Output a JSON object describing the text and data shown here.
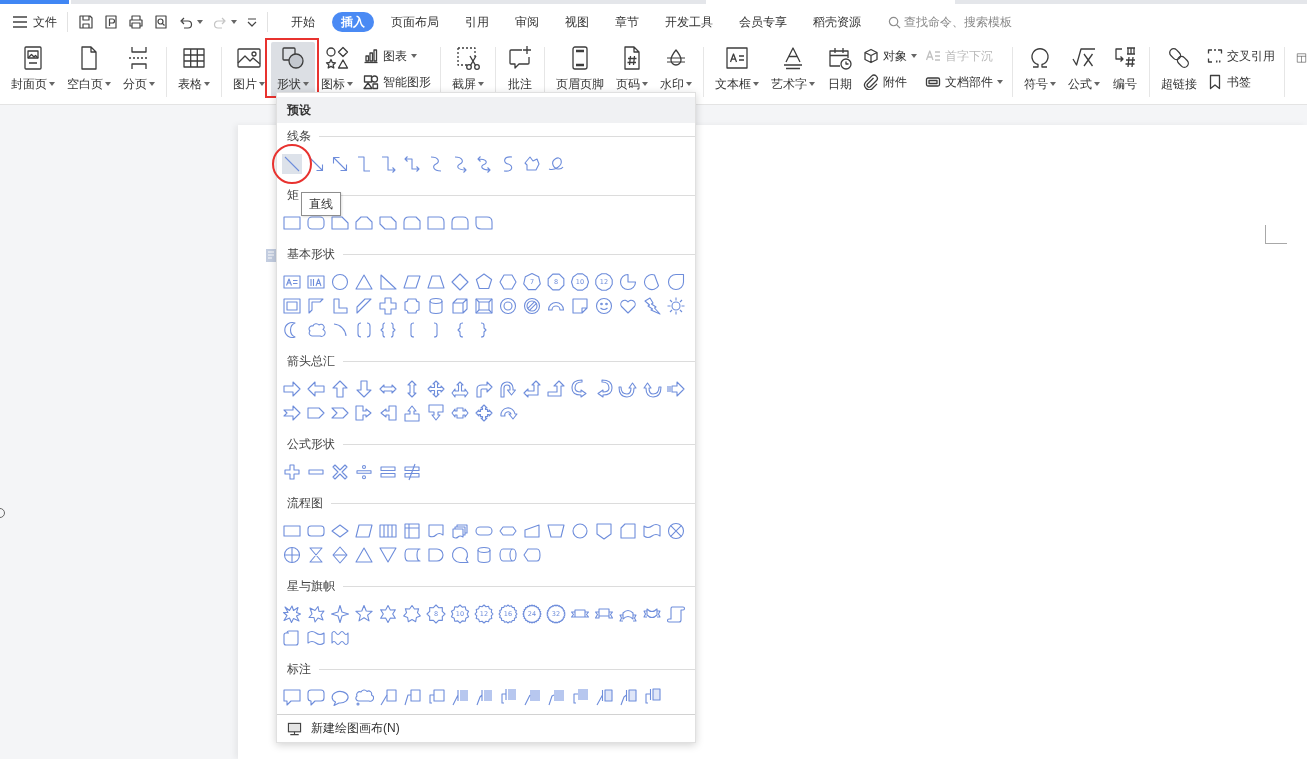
{
  "menu": {
    "label": "文件"
  },
  "quick_tools": [
    {
      "dropdown": false,
      "disabled": false
    },
    {
      "dropdown": false,
      "disabled": false
    },
    {
      "dropdown": false,
      "disabled": false
    },
    {
      "dropdown": false,
      "disabled": false
    },
    {
      "dropdown": true,
      "disabled": false
    },
    {
      "dropdown": true,
      "disabled": true
    },
    {
      "dropdown": false,
      "disabled": false
    }
  ],
  "tabs": [
    {
      "label": "开始",
      "selected": false
    },
    {
      "label": "插入",
      "selected": true
    },
    {
      "label": "页面布局",
      "selected": false
    },
    {
      "label": "引用",
      "selected": false
    },
    {
      "label": "审阅",
      "selected": false
    },
    {
      "label": "视图",
      "selected": false
    },
    {
      "label": "章节",
      "selected": false
    },
    {
      "label": "开发工具",
      "selected": false
    },
    {
      "label": "会员专享",
      "selected": false
    },
    {
      "label": "稻壳资源",
      "selected": false
    }
  ],
  "search": {
    "placeholder": "查找命令、搜索模板"
  },
  "ribbon": {
    "groups": [
      {
        "items": [
          {
            "kind": "large",
            "label": "封面页",
            "dropdown": true,
            "pressed": false,
            "disabled": false,
            "marked": false
          },
          {
            "kind": "large",
            "label": "空白页",
            "dropdown": true,
            "pressed": false,
            "disabled": false,
            "marked": false
          },
          {
            "kind": "large",
            "label": "分页",
            "dropdown": true,
            "pressed": false,
            "disabled": false,
            "marked": false
          }
        ]
      },
      {
        "items": [
          {
            "kind": "large",
            "label": "表格",
            "dropdown": true,
            "pressed": false,
            "disabled": false,
            "marked": false
          }
        ]
      },
      {
        "items": [
          {
            "kind": "large",
            "label": "图片",
            "dropdown": true,
            "pressed": false,
            "disabled": false,
            "marked": false
          },
          {
            "kind": "large",
            "label": "形状",
            "dropdown": true,
            "pressed": true,
            "disabled": false,
            "marked": true
          },
          {
            "kind": "large",
            "label": "图标",
            "dropdown": true,
            "pressed": false,
            "disabled": false,
            "marked": false
          },
          {
            "kind": "stack",
            "buttons": [
              {
                "label": "图表",
                "dropdown": true,
                "pressed": false,
                "disabled": false,
                "marked": false
              },
              {
                "label": "智能图形",
                "dropdown": false,
                "pressed": false,
                "disabled": false,
                "marked": false
              }
            ]
          }
        ]
      },
      {
        "items": [
          {
            "kind": "large",
            "label": "截屏",
            "dropdown": true,
            "pressed": false,
            "disabled": false,
            "marked": false
          }
        ]
      },
      {
        "items": [
          {
            "kind": "large",
            "label": "批注",
            "dropdown": false,
            "pressed": false,
            "disabled": false,
            "marked": false
          }
        ]
      },
      {
        "items": [
          {
            "kind": "large",
            "label": "页眉页脚",
            "dropdown": false,
            "pressed": false,
            "disabled": false,
            "marked": false
          },
          {
            "kind": "large",
            "label": "页码",
            "dropdown": true,
            "pressed": false,
            "disabled": false,
            "marked": false
          },
          {
            "kind": "large",
            "label": "水印",
            "dropdown": true,
            "pressed": false,
            "disabled": false,
            "marked": false
          }
        ]
      },
      {
        "items": [
          {
            "kind": "large",
            "label": "文本框",
            "dropdown": true,
            "pressed": false,
            "disabled": false,
            "marked": false
          },
          {
            "kind": "large",
            "label": "艺术字",
            "dropdown": true,
            "pressed": false,
            "disabled": false,
            "marked": false
          },
          {
            "kind": "large",
            "label": "日期",
            "dropdown": false,
            "pressed": false,
            "disabled": false,
            "marked": false
          },
          {
            "kind": "stack",
            "buttons": [
              {
                "label": "对象",
                "dropdown": true,
                "pressed": false,
                "disabled": false,
                "marked": false
              },
              {
                "label": "附件",
                "dropdown": false,
                "pressed": false,
                "disabled": false,
                "marked": false
              }
            ]
          },
          {
            "kind": "stack",
            "buttons": [
              {
                "label": "首字下沉",
                "dropdown": false,
                "pressed": false,
                "disabled": true,
                "marked": false
              },
              {
                "label": "文档部件",
                "dropdown": true,
                "pressed": false,
                "disabled": false,
                "marked": false
              }
            ]
          }
        ]
      },
      {
        "items": [
          {
            "kind": "large",
            "label": "符号",
            "dropdown": true,
            "pressed": false,
            "disabled": false,
            "marked": false
          },
          {
            "kind": "large",
            "label": "公式",
            "dropdown": true,
            "pressed": false,
            "disabled": false,
            "marked": false
          },
          {
            "kind": "large",
            "label": "编号",
            "dropdown": false,
            "pressed": false,
            "disabled": false,
            "marked": false
          }
        ]
      },
      {
        "items": [
          {
            "kind": "large",
            "label": "超链接",
            "dropdown": false,
            "pressed": false,
            "disabled": false,
            "marked": false
          },
          {
            "kind": "stack",
            "buttons": [
              {
                "label": "交叉引用",
                "dropdown": false,
                "pressed": false,
                "disabled": false,
                "marked": false
              },
              {
                "label": "书签",
                "dropdown": false,
                "pressed": false,
                "disabled": false,
                "marked": false
              }
            ]
          }
        ]
      }
    ]
  },
  "shapes_panel": {
    "header": "预设",
    "tooltip": "直线",
    "sections": [
      {
        "title": "线条",
        "shapes": [
          {
            "hovered": true,
            "marked": true
          },
          {
            "hovered": false,
            "marked": false
          },
          {
            "hovered": false,
            "marked": false
          },
          {
            "hovered": false,
            "marked": false
          },
          {
            "hovered": false,
            "marked": false
          },
          {
            "hovered": false,
            "marked": false
          },
          {
            "hovered": false,
            "marked": false
          },
          {
            "hovered": false,
            "marked": false
          },
          {
            "hovered": false,
            "marked": false
          },
          {
            "hovered": false,
            "marked": false
          },
          {
            "hovered": false,
            "marked": false
          },
          {
            "hovered": false,
            "marked": false
          }
        ]
      },
      {
        "title": "矩",
        "shapes": [
          {
            "hovered": false,
            "marked": false
          },
          {
            "hovered": false,
            "marked": false
          },
          {
            "hovered": false,
            "marked": false
          },
          {
            "hovered": false,
            "marked": false
          },
          {
            "hovered": false,
            "marked": false
          },
          {
            "hovered": false,
            "marked": false
          },
          {
            "hovered": false,
            "marked": false
          },
          {
            "hovered": false,
            "marked": false
          },
          {
            "hovered": false,
            "marked": false
          }
        ]
      },
      {
        "title": "基本形状",
        "shapes": [
          {
            "hovered": false,
            "marked": false
          },
          {
            "hovered": false,
            "marked": false
          },
          {
            "hovered": false,
            "marked": false
          },
          {
            "hovered": false,
            "marked": false
          },
          {
            "hovered": false,
            "marked": false
          },
          {
            "hovered": false,
            "marked": false
          },
          {
            "hovered": false,
            "marked": false
          },
          {
            "hovered": false,
            "marked": false
          },
          {
            "hovered": false,
            "marked": false
          },
          {
            "hovered": false,
            "marked": false
          },
          {
            "label": "7",
            "hovered": false,
            "marked": false
          },
          {
            "label": "8",
            "hovered": false,
            "marked": false
          },
          {
            "label": "10",
            "hovered": false,
            "marked": false
          },
          {
            "label": "12",
            "hovered": false,
            "marked": false
          },
          {
            "hovered": false,
            "marked": false
          },
          {
            "hovered": false,
            "marked": false
          },
          {
            "hovered": false,
            "marked": false
          },
          {
            "hovered": false,
            "marked": false
          },
          {
            "hovered": false,
            "marked": false
          },
          {
            "hovered": false,
            "marked": false
          },
          {
            "hovered": false,
            "marked": false
          },
          {
            "hovered": false,
            "marked": false
          },
          {
            "hovered": false,
            "marked": false
          },
          {
            "hovered": false,
            "marked": false
          },
          {
            "hovered": false,
            "marked": false
          },
          {
            "hovered": false,
            "marked": false
          },
          {
            "hovered": false,
            "marked": false
          },
          {
            "hovered": false,
            "marked": false
          },
          {
            "hovered": false,
            "marked": false
          },
          {
            "hovered": false,
            "marked": false
          },
          {
            "hovered": false,
            "marked": false
          },
          {
            "hovered": false,
            "marked": false
          },
          {
            "hovered": false,
            "marked": false
          },
          {
            "hovered": false,
            "marked": false
          },
          {
            "hovered": false,
            "marked": false
          },
          {
            "hovered": false,
            "marked": false
          },
          {
            "hovered": false,
            "marked": false
          },
          {
            "hovered": false,
            "marked": false
          },
          {
            "hovered": false,
            "marked": false
          },
          {
            "hovered": false,
            "marked": false
          },
          {
            "hovered": false,
            "marked": false
          },
          {
            "hovered": false,
            "marked": false
          },
          {
            "hovered": false,
            "marked": false
          }
        ]
      },
      {
        "title": "箭头总汇",
        "shapes": [
          {
            "hovered": false,
            "marked": false
          },
          {
            "hovered": false,
            "marked": false
          },
          {
            "hovered": false,
            "marked": false
          },
          {
            "hovered": false,
            "marked": false
          },
          {
            "hovered": false,
            "marked": false
          },
          {
            "hovered": false,
            "marked": false
          },
          {
            "hovered": false,
            "marked": false
          },
          {
            "hovered": false,
            "marked": false
          },
          {
            "hovered": false,
            "marked": false
          },
          {
            "hovered": false,
            "marked": false
          },
          {
            "hovered": false,
            "marked": false
          },
          {
            "hovered": false,
            "marked": false
          },
          {
            "hovered": false,
            "marked": false
          },
          {
            "hovered": false,
            "marked": false
          },
          {
            "hovered": false,
            "marked": false
          },
          {
            "hovered": false,
            "marked": false
          },
          {
            "hovered": false,
            "marked": false
          },
          {
            "hovered": false,
            "marked": false
          },
          {
            "hovered": false,
            "marked": false
          },
          {
            "hovered": false,
            "marked": false
          },
          {
            "hovered": false,
            "marked": false
          },
          {
            "hovered": false,
            "marked": false
          },
          {
            "hovered": false,
            "marked": false
          },
          {
            "hovered": false,
            "marked": false
          },
          {
            "hovered": false,
            "marked": false
          },
          {
            "hovered": false,
            "marked": false
          },
          {
            "hovered": false,
            "marked": false
          }
        ]
      },
      {
        "title": "公式形状",
        "shapes": [
          {
            "hovered": false,
            "marked": false
          },
          {
            "hovered": false,
            "marked": false
          },
          {
            "hovered": false,
            "marked": false
          },
          {
            "hovered": false,
            "marked": false
          },
          {
            "hovered": false,
            "marked": false
          },
          {
            "hovered": false,
            "marked": false
          }
        ]
      },
      {
        "title": "流程图",
        "shapes": [
          {
            "hovered": false,
            "marked": false
          },
          {
            "hovered": false,
            "marked": false
          },
          {
            "hovered": false,
            "marked": false
          },
          {
            "hovered": false,
            "marked": false
          },
          {
            "hovered": false,
            "marked": false
          },
          {
            "hovered": false,
            "marked": false
          },
          {
            "hovered": false,
            "marked": false
          },
          {
            "hovered": false,
            "marked": false
          },
          {
            "hovered": false,
            "marked": false
          },
          {
            "hovered": false,
            "marked": false
          },
          {
            "hovered": false,
            "marked": false
          },
          {
            "hovered": false,
            "marked": false
          },
          {
            "hovered": false,
            "marked": false
          },
          {
            "hovered": false,
            "marked": false
          },
          {
            "hovered": false,
            "marked": false
          },
          {
            "hovered": false,
            "marked": false
          },
          {
            "hovered": false,
            "marked": false
          },
          {
            "hovered": false,
            "marked": false
          },
          {
            "hovered": false,
            "marked": false
          },
          {
            "hovered": false,
            "marked": false
          },
          {
            "hovered": false,
            "marked": false
          },
          {
            "hovered": false,
            "marked": false
          },
          {
            "hovered": false,
            "marked": false
          },
          {
            "hovered": false,
            "marked": false
          },
          {
            "hovered": false,
            "marked": false
          },
          {
            "hovered": false,
            "marked": false
          },
          {
            "hovered": false,
            "marked": false
          },
          {
            "hovered": false,
            "marked": false
          }
        ]
      },
      {
        "title": "星与旗帜",
        "shapes": [
          {
            "hovered": false,
            "marked": false
          },
          {
            "hovered": false,
            "marked": false
          },
          {
            "hovered": false,
            "marked": false
          },
          {
            "hovered": false,
            "marked": false
          },
          {
            "hovered": false,
            "marked": false
          },
          {
            "hovered": false,
            "marked": false
          },
          {
            "label": "8",
            "hovered": false,
            "marked": false
          },
          {
            "label": "10",
            "hovered": false,
            "marked": false
          },
          {
            "label": "12",
            "hovered": false,
            "marked": false
          },
          {
            "label": "16",
            "hovered": false,
            "marked": false
          },
          {
            "label": "24",
            "hovered": false,
            "marked": false
          },
          {
            "label": "32",
            "hovered": false,
            "marked": false
          },
          {
            "hovered": false,
            "marked": false
          },
          {
            "hovered": false,
            "marked": false
          },
          {
            "hovered": false,
            "marked": false
          },
          {
            "hovered": false,
            "marked": false
          },
          {
            "hovered": false,
            "marked": false
          },
          {
            "hovered": false,
            "marked": false
          },
          {
            "hovered": false,
            "marked": false
          },
          {
            "hovered": false,
            "marked": false
          }
        ]
      },
      {
        "title": "标注",
        "shapes": [
          {
            "hovered": false,
            "marked": false
          },
          {
            "hovered": false,
            "marked": false
          },
          {
            "hovered": false,
            "marked": false
          },
          {
            "hovered": false,
            "marked": false
          },
          {
            "hovered": false,
            "marked": false
          },
          {
            "hovered": false,
            "marked": false
          },
          {
            "hovered": false,
            "marked": false
          },
          {
            "hovered": false,
            "marked": false
          },
          {
            "hovered": false,
            "marked": false
          },
          {
            "hovered": false,
            "marked": false
          },
          {
            "hovered": false,
            "marked": false
          },
          {
            "hovered": false,
            "marked": false
          },
          {
            "hovered": false,
            "marked": false
          },
          {
            "hovered": false,
            "marked": false
          },
          {
            "hovered": false,
            "marked": false
          },
          {
            "hovered": false,
            "marked": false
          }
        ]
      }
    ],
    "footer": {
      "label": "新建绘图画布(N)"
    }
  }
}
